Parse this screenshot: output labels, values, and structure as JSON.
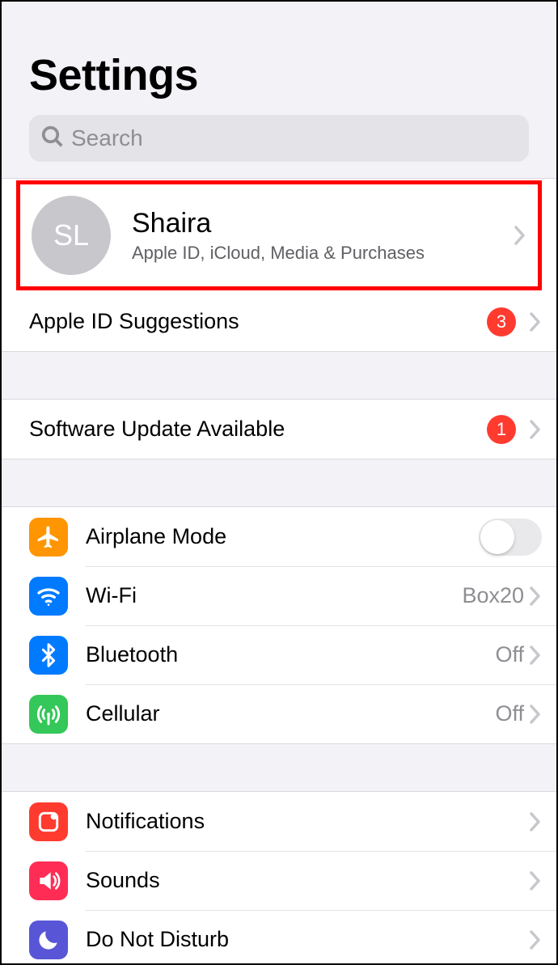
{
  "header": {
    "title": "Settings"
  },
  "search": {
    "placeholder": "Search"
  },
  "profile": {
    "initials": "SL",
    "name": "Shaira",
    "subtitle": "Apple ID, iCloud, Media & Purchases"
  },
  "apple_id_suggestions": {
    "label": "Apple ID Suggestions",
    "badge": "3"
  },
  "software_update": {
    "label": "Software Update Available",
    "badge": "1"
  },
  "connectivity": {
    "airplane": {
      "label": "Airplane Mode"
    },
    "wifi": {
      "label": "Wi-Fi",
      "value": "Box20"
    },
    "bluetooth": {
      "label": "Bluetooth",
      "value": "Off"
    },
    "cellular": {
      "label": "Cellular",
      "value": "Off"
    }
  },
  "system": {
    "notifications": {
      "label": "Notifications"
    },
    "sounds": {
      "label": "Sounds"
    },
    "dnd": {
      "label": "Do Not Disturb"
    }
  },
  "colors": {
    "orange": "#ff9500",
    "blue": "#007aff",
    "green": "#34c759",
    "red": "#ff3b30",
    "pink": "#ff2d55",
    "indigo": "#5856d6"
  }
}
